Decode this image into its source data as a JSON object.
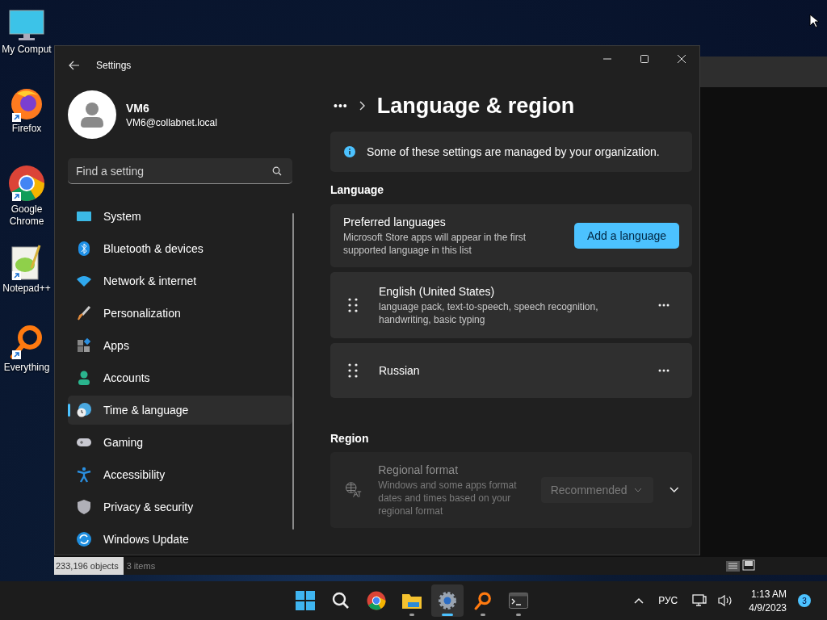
{
  "desktop_icons": [
    {
      "kind": "monitor",
      "label": "My Comput",
      "shortcut": false
    },
    {
      "kind": "firefox",
      "label": "Firefox",
      "shortcut": true
    },
    {
      "kind": "chrome",
      "label": "Google Chrome",
      "shortcut": true
    },
    {
      "kind": "notepad",
      "label": "Notepad++",
      "shortcut": true
    },
    {
      "kind": "everything",
      "label": "Everything",
      "shortcut": true
    }
  ],
  "background_window": {
    "status_bar": [
      "233,196 objects",
      "3 items"
    ]
  },
  "settings": {
    "title": "Settings",
    "user": {
      "name": "VM6",
      "email": "VM6@collabnet.local"
    },
    "search": {
      "placeholder": "Find a setting"
    },
    "nav_items": [
      {
        "kind": "system",
        "label": "System",
        "selected": false
      },
      {
        "kind": "bluetooth",
        "label": "Bluetooth & devices",
        "selected": false
      },
      {
        "kind": "network",
        "label": "Network & internet",
        "selected": false
      },
      {
        "kind": "brush",
        "label": "Personalization",
        "selected": false
      },
      {
        "kind": "apps",
        "label": "Apps",
        "selected": false
      },
      {
        "kind": "accounts",
        "label": "Accounts",
        "selected": false
      },
      {
        "kind": "time",
        "label": "Time & language",
        "selected": true
      },
      {
        "kind": "gaming",
        "label": "Gaming",
        "selected": false
      },
      {
        "kind": "accessibility",
        "label": "Accessibility",
        "selected": false
      },
      {
        "kind": "privacy",
        "label": "Privacy & security",
        "selected": false
      },
      {
        "kind": "update",
        "label": "Windows Update",
        "selected": false
      }
    ],
    "breadcrumb": {
      "more": "•••",
      "title": "Language & region"
    },
    "info_banner": "Some of these settings are managed by your organization.",
    "language_section": {
      "heading": "Language",
      "preferred": {
        "title": "Preferred languages",
        "description": "Microsoft Store apps will appear in the first supported language in this list",
        "button": "Add a language"
      },
      "languages": [
        {
          "name": "English (United States)",
          "features": "language pack, text-to-speech, speech recognition, handwriting, basic typing"
        },
        {
          "name": "Russian"
        }
      ]
    },
    "region_section": {
      "heading": "Region",
      "regional_format": {
        "title": "Regional format",
        "description": "Windows and some apps format dates and times based on your regional format",
        "value": "Recommended",
        "disabled": true,
        "expanded": false
      }
    }
  },
  "taskbar": {
    "apps": [
      {
        "kind": "start",
        "running": false,
        "selected": false
      },
      {
        "kind": "search",
        "running": false,
        "selected": false
      },
      {
        "kind": "chrome",
        "running": false,
        "selected": false
      },
      {
        "kind": "explorer",
        "running": true,
        "selected": false
      },
      {
        "kind": "settings",
        "running": true,
        "selected": true
      },
      {
        "kind": "everything",
        "running": true,
        "selected": false
      },
      {
        "kind": "terminal",
        "running": true,
        "selected": false
      }
    ],
    "language": "РУС",
    "time": "1:13 AM",
    "date": "4/9/2023",
    "notifications": "3"
  }
}
